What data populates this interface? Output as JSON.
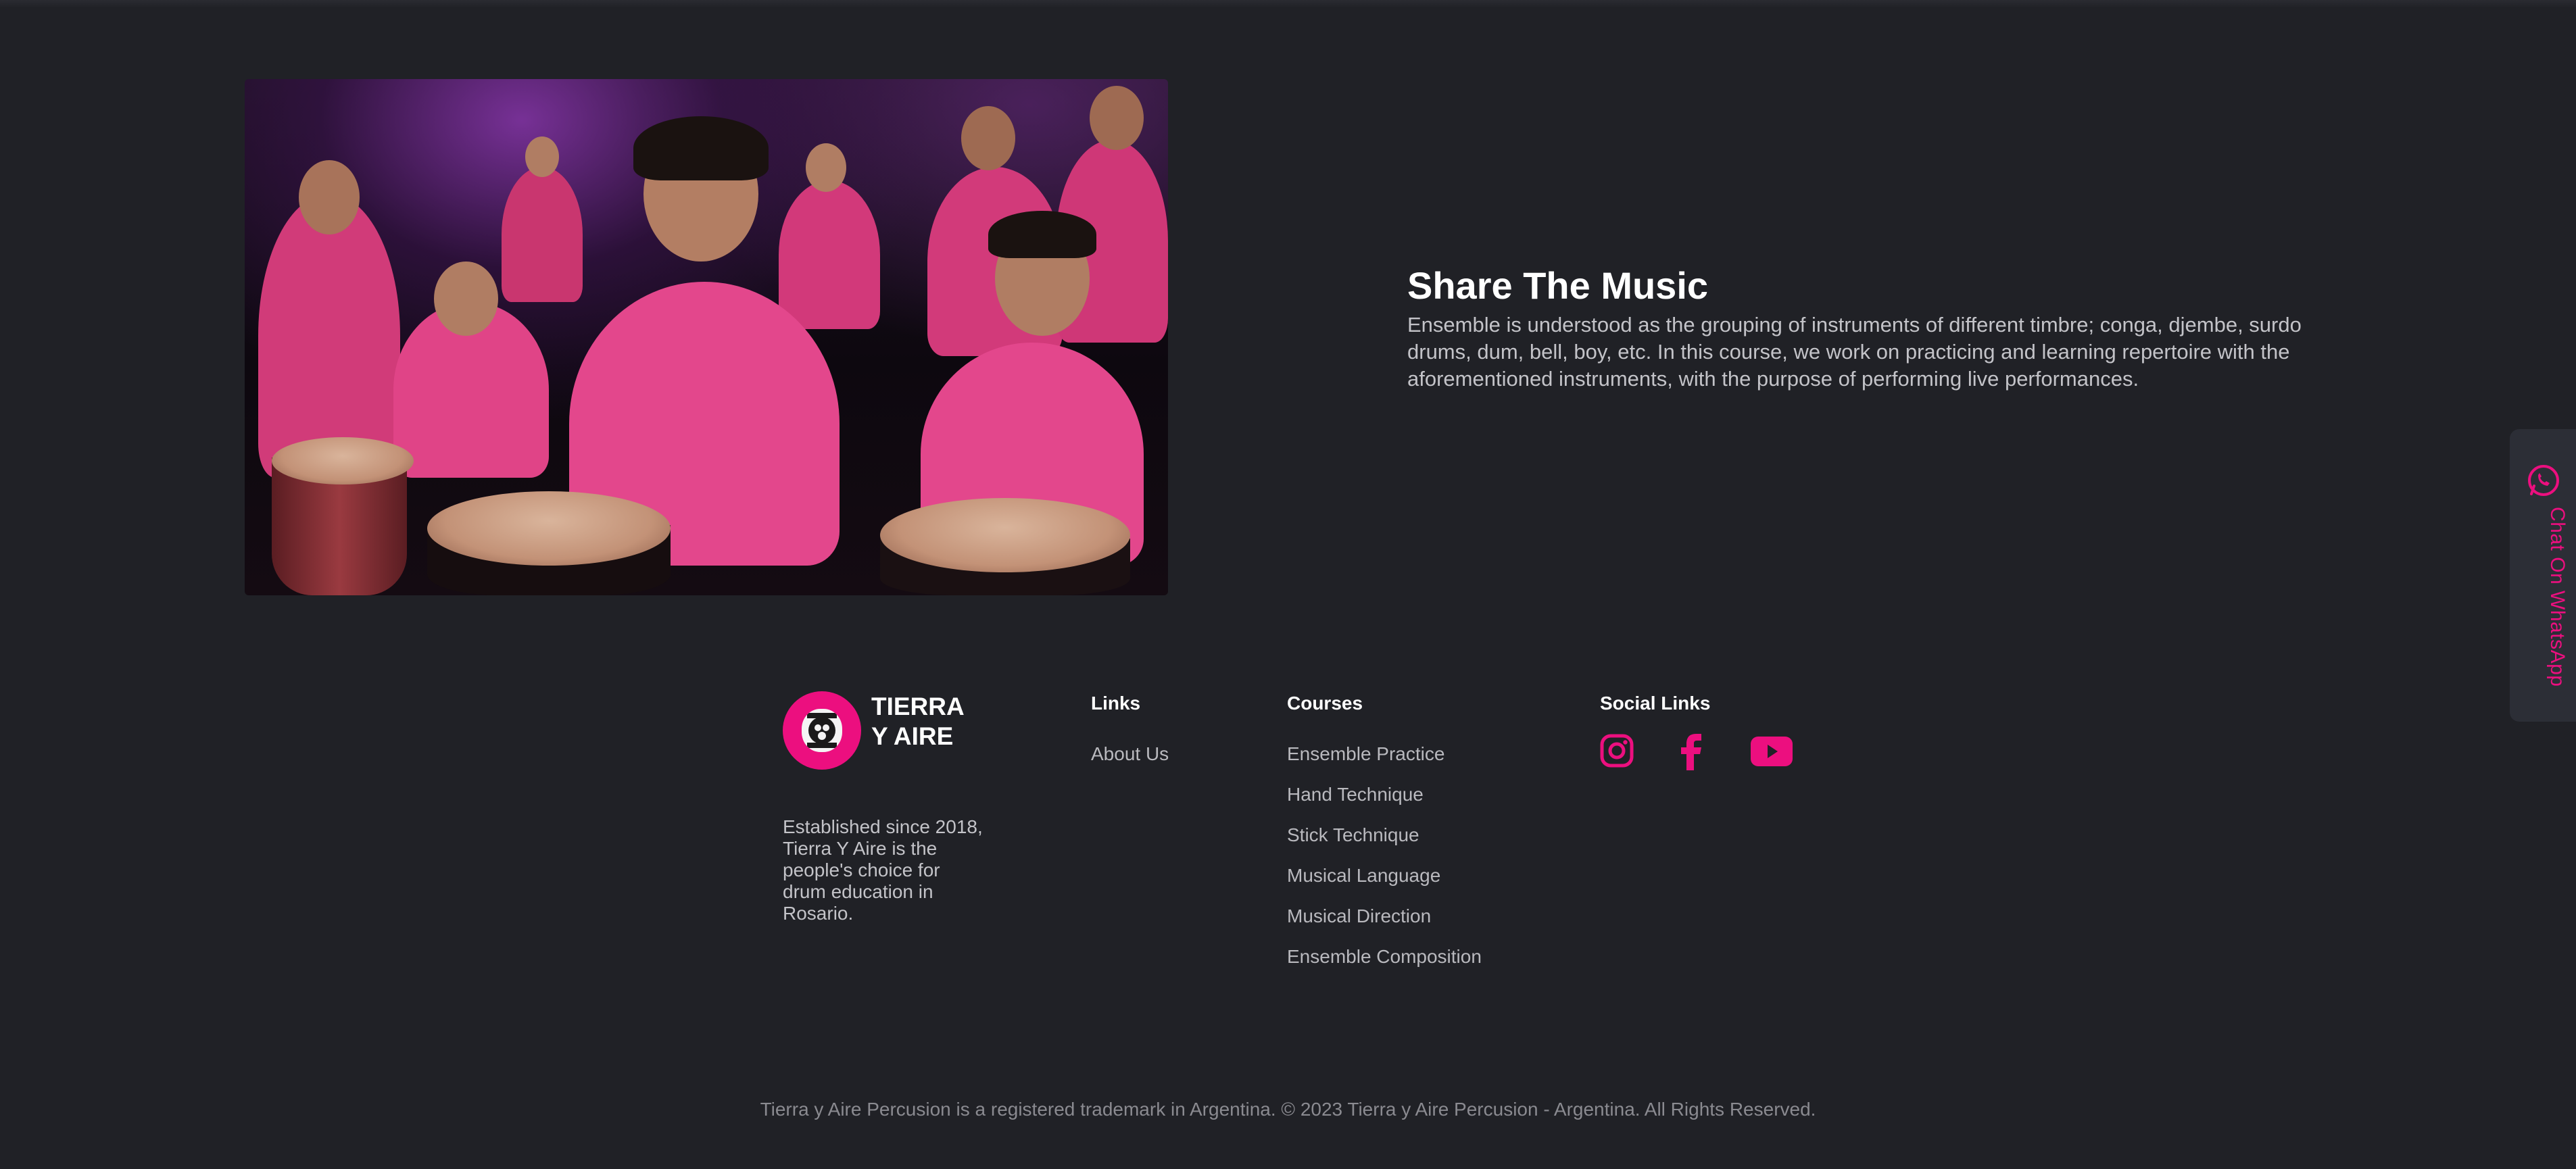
{
  "hero": {
    "title": "Share The Music",
    "body": "Ensemble is understood as the grouping of instruments of different timbre; conga, djembe, surdo drums, dum, bell, boy, etc. In this course, we work on practicing and learning repertoire with the aforementioned instruments, with the purpose of performing live performances."
  },
  "whatsapp": {
    "label": "Chat On WhatsApp",
    "icon": "whatsapp-icon"
  },
  "footer": {
    "brand": {
      "name_line1": "TIERRA",
      "name_line2": "Y AIRE",
      "about": "Established since 2018, Tierra Y Aire is the people's choice for drum education in Rosario."
    },
    "links": {
      "heading": "Links",
      "items": [
        "About Us"
      ]
    },
    "courses": {
      "heading": "Courses",
      "items": [
        "Ensemble Practice",
        "Hand Technique",
        "Stick Technique",
        "Musical Language",
        "Musical Direction",
        "Ensemble Composition"
      ]
    },
    "social": {
      "heading": "Social Links",
      "icons": [
        "instagram-icon",
        "facebook-icon",
        "youtube-icon"
      ]
    },
    "copyright": "Tierra y Aire Percusion is a registered trademark in Argentina. © 2023 Tierra y Aire Percusion - Argentina. All Rights Reserved."
  },
  "colors": {
    "accent": "#ec0f7f",
    "background": "#202126",
    "panel": "#2c2e36"
  }
}
